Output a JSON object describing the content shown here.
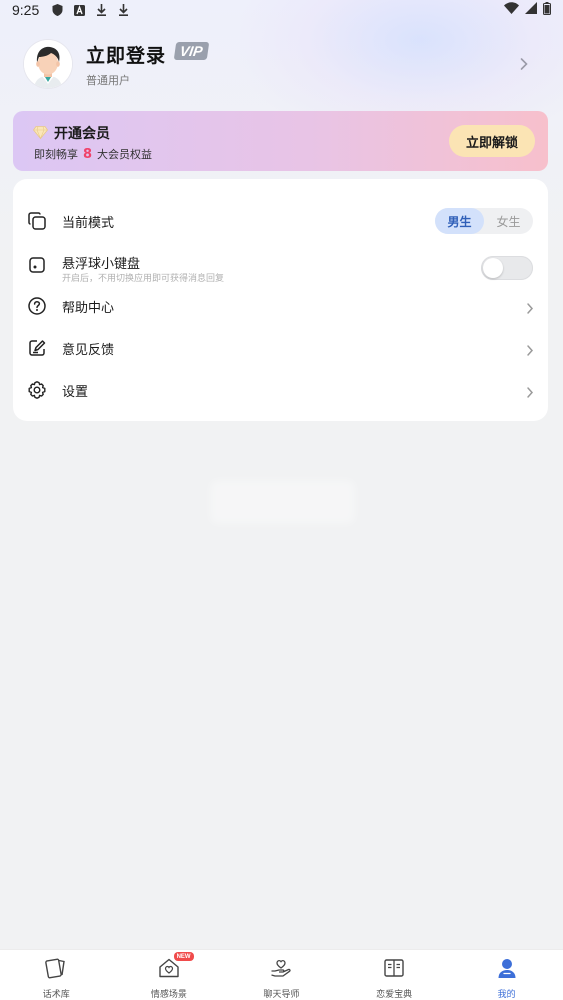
{
  "status_bar": {
    "time": "9:25",
    "left_icons": [
      "shield-icon",
      "font-a-icon",
      "download-icon",
      "download-icon"
    ],
    "right_icons": [
      "wifi-icon",
      "signal-icon",
      "battery-icon"
    ]
  },
  "profile": {
    "login_title": "立即登录",
    "vip_badge": "VIP",
    "user_type": "普通用户"
  },
  "vip_card": {
    "title": "开通会员",
    "sub_prefix": "即刻畅享",
    "benefit_count": "8",
    "sub_suffix": "大会员权益",
    "unlock_label": "立即解锁",
    "colors": {
      "gradient_start": "#dcc7f4",
      "gradient_end": "#f7c0cc",
      "button": "#fbe4b4",
      "count": "#f0426a"
    }
  },
  "settings": {
    "mode": {
      "label": "当前模式",
      "options": [
        "男生",
        "女生"
      ],
      "selected": "男生"
    },
    "floating_keyboard": {
      "label": "悬浮球小键盘",
      "hint": "开启后，不用切换应用即可获得消息回复",
      "enabled": false
    },
    "help_label": "帮助中心",
    "feedback_label": "意见反馈",
    "settings_label": "设置"
  },
  "bottom_nav": {
    "items": [
      {
        "label": "话术库",
        "icon": "cards-icon"
      },
      {
        "label": "情感场景",
        "icon": "heart-house-icon",
        "badge": "NEW"
      },
      {
        "label": "聊天导师",
        "icon": "heart-hand-icon"
      },
      {
        "label": "恋爱宝典",
        "icon": "book-icon"
      },
      {
        "label": "我的",
        "icon": "user-icon"
      }
    ],
    "active": "我的",
    "accent_color": "#3d6fd8"
  }
}
